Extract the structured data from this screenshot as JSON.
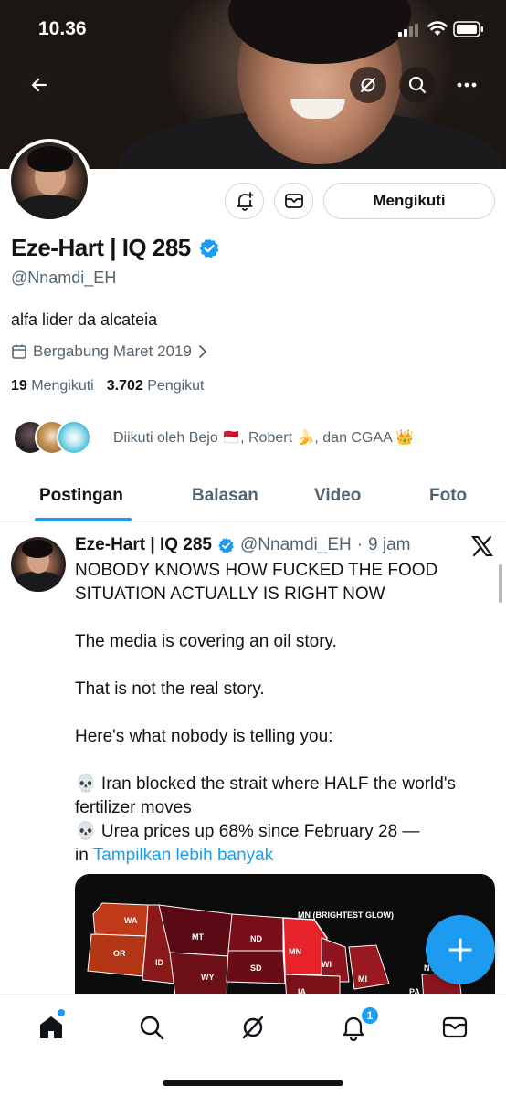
{
  "status_bar": {
    "time": "10.36"
  },
  "profile": {
    "name": "Eze-Hart | IQ 285",
    "handle": "@Nnamdi_EH",
    "bio": "alfa lider da alcateia",
    "joined": "Bergabung Maret 2019",
    "following_count": "19",
    "following_label": "Mengikuti",
    "followers_count": "3.702",
    "followers_label": "Pengikut",
    "followed_by": "Diikuti oleh Bejo 🇲🇨, Robert 🍌, dan CGAA 👑",
    "follow_button": "Mengikuti"
  },
  "tabs": [
    {
      "label": "Postingan",
      "active": true
    },
    {
      "label": "Balasan",
      "active": false
    },
    {
      "label": "Video",
      "active": false
    },
    {
      "label": "Foto",
      "active": false
    }
  ],
  "post": {
    "author": "Eze-Hart | IQ 285",
    "handle": "@Nnamdi_EH",
    "sep": "·",
    "time": "9 jam",
    "body": "NOBODY KNOWS HOW FUCKED THE FOOD SITUATION ACTUALLY IS RIGHT NOW\n\nThe media is covering an oil story.\n\nThat is not the real story.\n\nHere's what nobody is telling you:\n\n💀 Iran blocked the strait where HALF the world's fertilizer moves\n💀 Urea prices up 68% since February 28 —\nin ",
    "more_link": "Tampilkan lebih banyak",
    "map_labels": {
      "wa": "WA",
      "or": "OR",
      "id": "ID",
      "mt": "MT",
      "wy": "WY",
      "nd": "ND",
      "sd": "SD",
      "mn": "MN",
      "mn_caption": "MN (BRIGHTEST GLOW)",
      "wi": "WI",
      "mi": "MI",
      "ia": "IA",
      "pa": "PA",
      "ny": "NY"
    }
  },
  "nav": {
    "notifications_badge": "1"
  },
  "colors": {
    "accent": "#1d9bf0",
    "verified": "#1d9bf0"
  }
}
